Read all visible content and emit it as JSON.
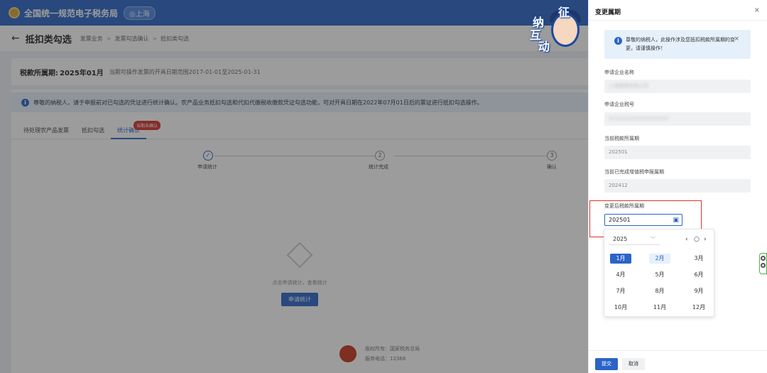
{
  "header": {
    "site_name": "全国统一规范电子税务局",
    "region": "◎上海"
  },
  "breadcrumb": {
    "title": "抵扣类勾选",
    "items": [
      "发票业务",
      "发票勾选确认",
      "抵扣类勾选"
    ]
  },
  "period": {
    "label": "税款所属期:",
    "value": "2025年01月",
    "range_text": "当期可操作发票的开具日期范围2017-01-01至2025-01-31"
  },
  "notice": {
    "text": "尊敬的纳税人，请于申报前对已勾选的凭证进行统计确认。农产品业务抵扣勾选和代扣代缴税收缴款凭证勾选功能，可对开具日期在2022年07月01日后的票证进行抵扣勾选操作。"
  },
  "tabs": [
    {
      "label": "待处理农产品发票"
    },
    {
      "label": "抵扣勾选"
    },
    {
      "label": "统计确认"
    }
  ],
  "tab_badge": "当期未确认",
  "steps": [
    {
      "number": "✓",
      "label": "申请统计"
    },
    {
      "number": "2",
      "label": "统计完成"
    },
    {
      "number": "3",
      "label": "确认"
    }
  ],
  "empty_state": {
    "text": "点击申请统计，查看统计",
    "button": "申请统计"
  },
  "footer": {
    "owner": "版权所有：国家税务总局",
    "phone": "服务电话：12366"
  },
  "mascot": {
    "chars": [
      "征",
      "纳",
      "互",
      "动"
    ]
  },
  "drawer": {
    "title": "变更属期",
    "close": "×",
    "notice": "尊敬的纳税人，此操作涉及您抵扣税款所属期的变更，请谨慎操作！",
    "notice_close": "×",
    "fields": [
      {
        "label": "申请企业名称",
        "value": "上海某某有限公司"
      },
      {
        "label": "申请企业税号",
        "value": "9131XXXXXXXXXXXXXX"
      },
      {
        "label": "当前税款所属期",
        "value": "202501"
      },
      {
        "label": "当前已完成增值税申报属期",
        "value": "202412"
      }
    ],
    "new_period_label": "变更后税款所属期",
    "new_period_value": "202501",
    "submit": "提交",
    "cancel": "取消"
  },
  "month_picker": {
    "year": "2025",
    "prev": "‹",
    "today": "○",
    "next": "›",
    "months": [
      "1月",
      "2月",
      "3月",
      "4月",
      "5月",
      "6月",
      "7月",
      "8月",
      "9月",
      "10月",
      "11月",
      "12月"
    ],
    "selected_index": 0,
    "current_index": 1
  },
  "colors": {
    "primary": "#2a64c8",
    "highlight": "#e0302a",
    "badge": "#d9302b"
  }
}
